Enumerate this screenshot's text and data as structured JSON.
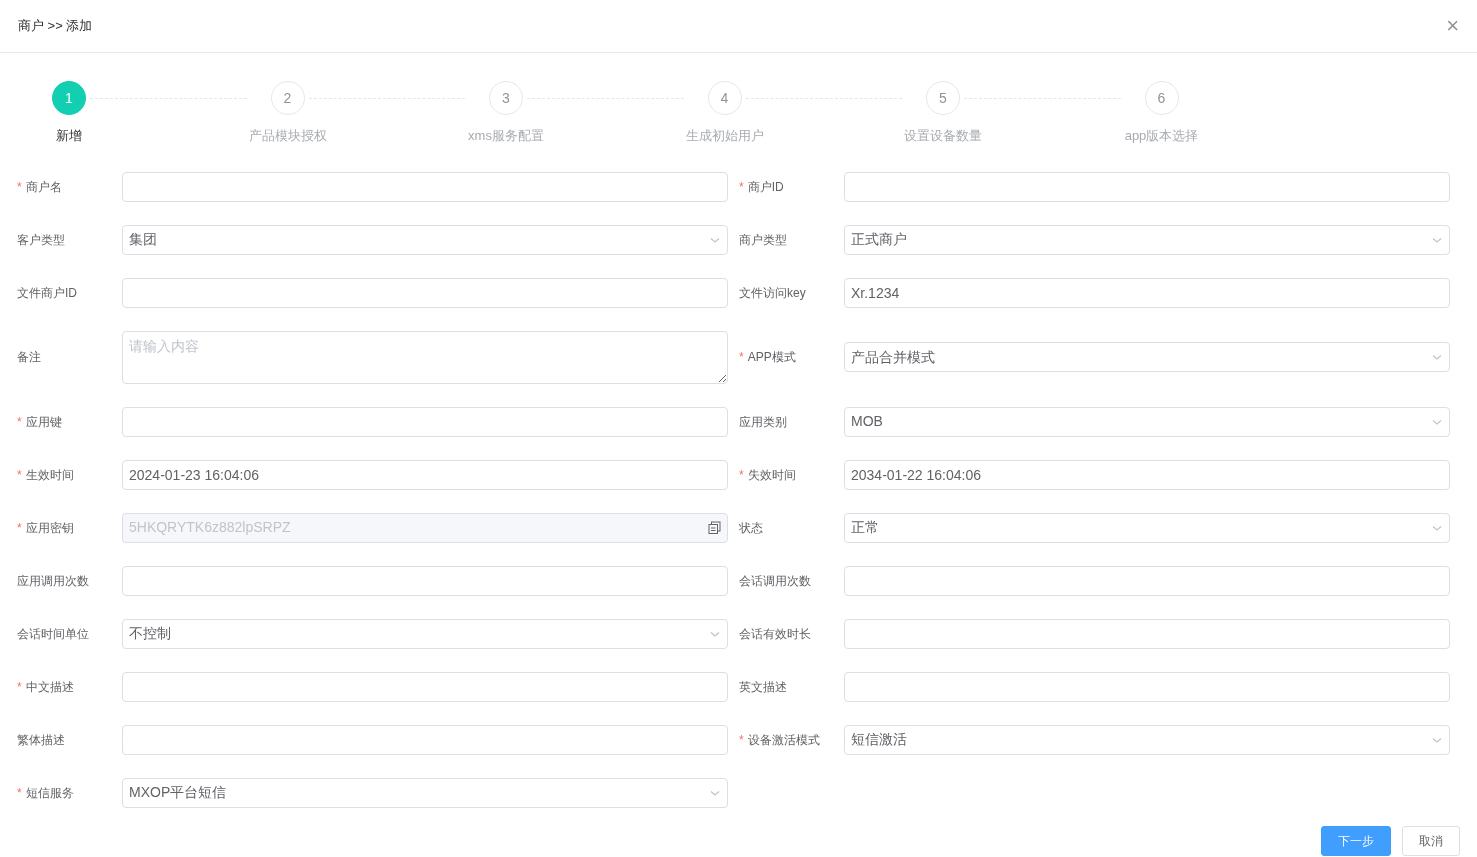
{
  "dialog": {
    "title": "商户 >> 添加",
    "close": "×"
  },
  "steps": [
    {
      "number": "1",
      "label": "新增",
      "active": true
    },
    {
      "number": "2",
      "label": "产品模块授权",
      "active": false
    },
    {
      "number": "3",
      "label": "xms服务配置",
      "active": false
    },
    {
      "number": "4",
      "label": "生成初始用户",
      "active": false
    },
    {
      "number": "5",
      "label": "设置设备数量",
      "active": false
    },
    {
      "number": "6",
      "label": "app版本选择",
      "active": false
    }
  ],
  "fields": [
    {
      "label": "商户名",
      "marker": "*",
      "kind": "text"
    },
    {
      "label": "商户ID",
      "marker": "*",
      "kind": "text"
    },
    {
      "label": "客户类型",
      "kind": "select",
      "value": "集团"
    },
    {
      "label": "商户类型",
      "kind": "select",
      "value": "正式商户"
    },
    {
      "label": "文件商户ID",
      "kind": "text"
    },
    {
      "label": "文件访问key",
      "kind": "text",
      "value": "Xr.1234"
    },
    {
      "label": "备注",
      "kind": "textarea",
      "placeholder": "请输入内容"
    },
    {
      "label": "APP模式",
      "marker": "*",
      "kind": "select",
      "value": "产品合并模式"
    },
    {
      "label": "应用键",
      "marker": "*",
      "kind": "text"
    },
    {
      "label": "应用类别",
      "kind": "select",
      "value": "MOB"
    },
    {
      "label": "生效时间",
      "marker": "*",
      "kind": "text",
      "value": "2024-01-23 16:04:06"
    },
    {
      "label": "失效时间",
      "marker": "*",
      "kind": "text",
      "value": "2034-01-22 16:04:06"
    },
    {
      "label": "应用密钥",
      "marker": "*",
      "kind": "disabled",
      "value": "5HKQRYTK6z882lpSRPZ"
    },
    {
      "label": "状态",
      "kind": "select",
      "value": "正常"
    },
    {
      "label": "应用调用次数",
      "kind": "text"
    },
    {
      "label": "会话调用次数",
      "kind": "text"
    },
    {
      "label": "会话时间单位",
      "kind": "select",
      "value": "不控制"
    },
    {
      "label": "会话有效时长",
      "kind": "text"
    },
    {
      "label": "中文描述",
      "marker": "*",
      "kind": "text"
    },
    {
      "label": "英文描述",
      "kind": "text"
    },
    {
      "label": "繁体描述",
      "kind": "text"
    },
    {
      "label": "设备激活模式",
      "marker": "*",
      "kind": "select",
      "value": "短信激活"
    },
    {
      "label": "短信服务",
      "marker": "*",
      "kind": "select",
      "value": "MXOP平台短信"
    }
  ],
  "buttons": [
    {
      "label": "下一步",
      "kind": "primary"
    },
    {
      "label": "取消",
      "kind": "default"
    }
  ]
}
